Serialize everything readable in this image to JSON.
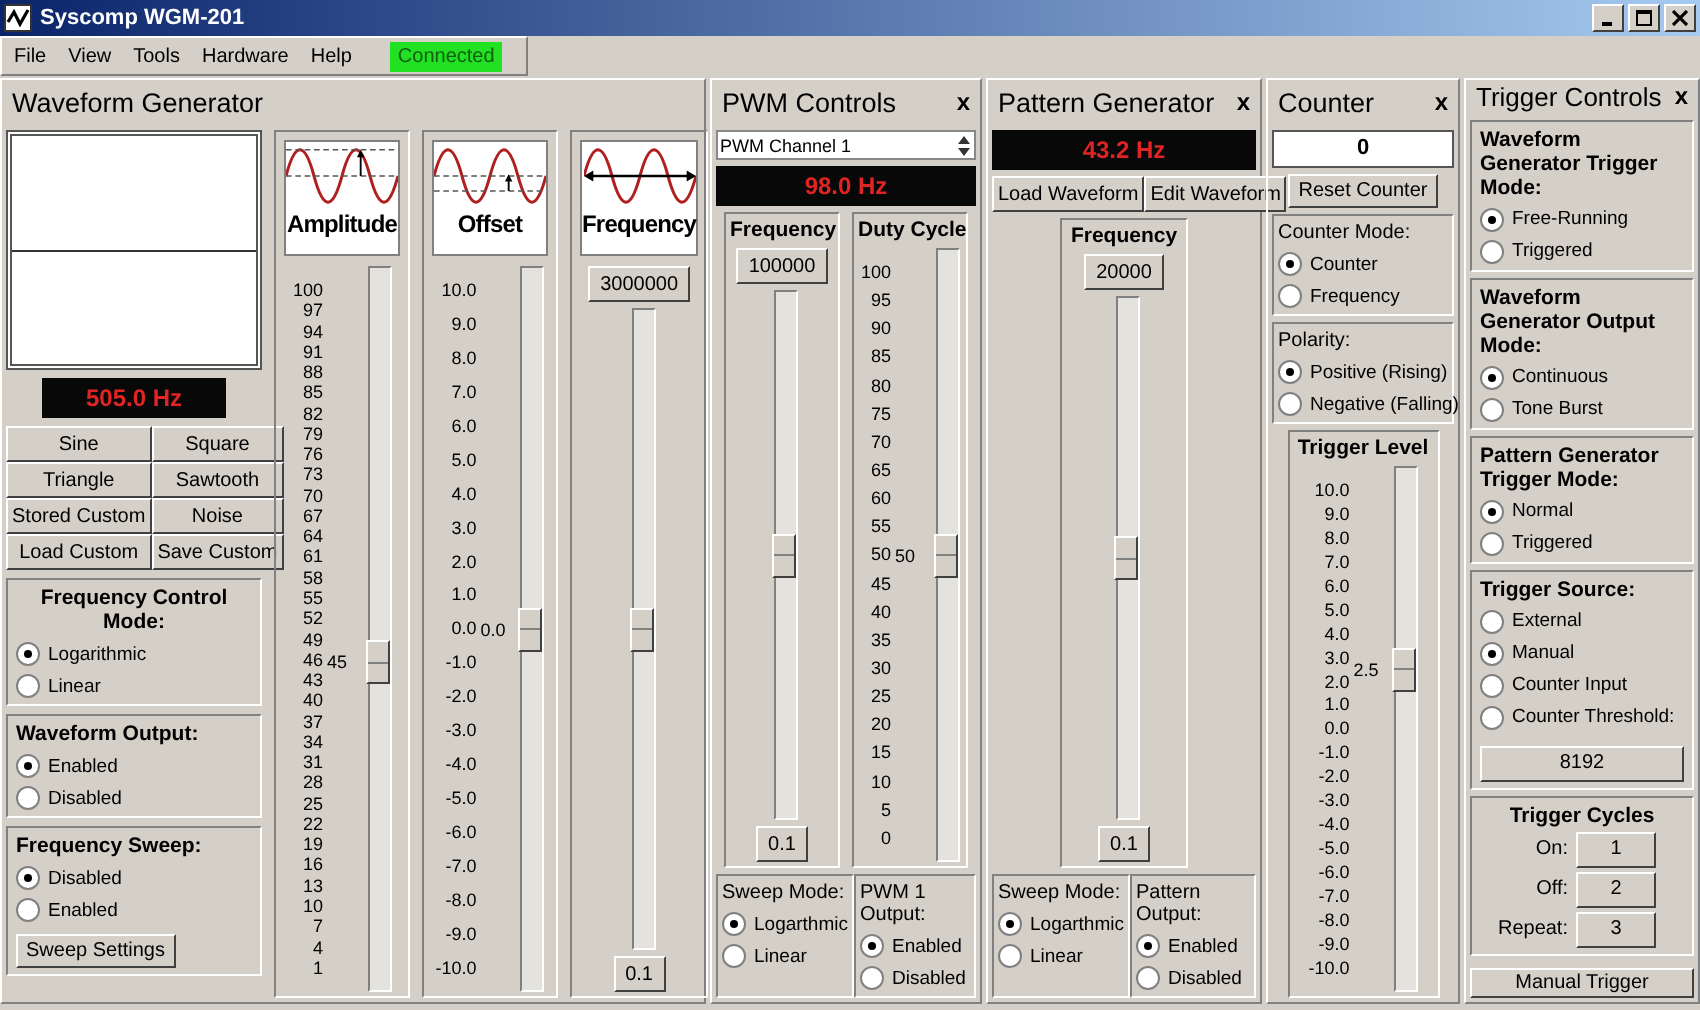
{
  "window": {
    "title": "Syscomp WGM-201"
  },
  "menu": [
    "File",
    "View",
    "Tools",
    "Hardware",
    "Help"
  ],
  "connection_status": "Connected",
  "waveform_generator": {
    "title": "Waveform Generator",
    "frequency_readout": "505.0 Hz",
    "wave_buttons": [
      "Sine",
      "Square",
      "Triangle",
      "Sawtooth",
      "Stored Custom",
      "Noise",
      "Load Custom",
      "Save Custom"
    ],
    "radio_groups": [
      {
        "title": "Frequency Control Mode:",
        "options": [
          {
            "label": "Logarithmic",
            "selected": true
          },
          {
            "label": "Linear",
            "selected": false
          }
        ]
      },
      {
        "title": "Waveform Output:",
        "options": [
          {
            "label": "Enabled",
            "selected": true
          },
          {
            "label": "Disabled",
            "selected": false
          }
        ]
      },
      {
        "title": "Frequency Sweep:",
        "options": [
          {
            "label": "Disabled",
            "selected": true
          },
          {
            "label": "Enabled",
            "selected": false
          }
        ]
      }
    ],
    "sweep_button": "Sweep Settings",
    "sliders": [
      {
        "kind": "amplitude",
        "caption": "Amplitude",
        "ticks": [
          "100",
          "97",
          "94",
          "91",
          "88",
          "85",
          "82",
          "79",
          "76",
          "73",
          "70",
          "67",
          "64",
          "61",
          "58",
          "55",
          "52",
          "49",
          "46",
          "43",
          "40",
          "37",
          "34",
          "31",
          "28",
          "25",
          "22",
          "19",
          "16",
          "13",
          "10",
          "7",
          "4",
          "1"
        ],
        "value_label": "45",
        "level": 0.45
      },
      {
        "kind": "offset",
        "caption": "Offset",
        "ticks": [
          "10.0",
          "9.0",
          "8.0",
          "7.0",
          "6.0",
          "5.0",
          "4.0",
          "3.0",
          "2.0",
          "1.0",
          "0.0",
          "-1.0",
          "-2.0",
          "-3.0",
          "-4.0",
          "-5.0",
          "-6.0",
          "-7.0",
          "-8.0",
          "-9.0",
          "-10.0"
        ],
        "value_label": "0.0",
        "level": 0.5
      },
      {
        "kind": "frequency",
        "caption": "Frequency",
        "top_button": "3000000",
        "bottom_button": "0.1",
        "level": 0.5
      }
    ]
  },
  "pwm_controls": {
    "title": "PWM Controls",
    "close": "x",
    "channel": "PWM Channel 1",
    "frequency_readout": "98.0 Hz",
    "sliders": [
      {
        "heading": "Frequency",
        "top_button": "100000",
        "bottom_button": "0.1",
        "level": 0.5
      },
      {
        "heading": "Duty Cycle",
        "ticks": [
          "100",
          "95",
          "90",
          "85",
          "80",
          "75",
          "70",
          "65",
          "60",
          "55",
          "50",
          "45",
          "40",
          "35",
          "30",
          "25",
          "20",
          "15",
          "10",
          "5",
          "0"
        ],
        "value_label": "50",
        "level": 0.5
      }
    ],
    "radio_groups": [
      {
        "title": "Sweep Mode:",
        "options": [
          {
            "label": "Logarthmic",
            "selected": true
          },
          {
            "label": "Linear",
            "selected": false
          }
        ]
      },
      {
        "title": "PWM 1 Output:",
        "options": [
          {
            "label": "Enabled",
            "selected": true
          },
          {
            "label": "Disabled",
            "selected": false
          }
        ]
      }
    ]
  },
  "pattern_generator": {
    "title": "Pattern Generator",
    "close": "x",
    "frequency_readout": "43.2 Hz",
    "buttons": [
      "Load Waveform",
      "Edit Waveform"
    ],
    "slider": {
      "heading": "Frequency",
      "top_button": "20000",
      "bottom_button": "0.1",
      "level": 0.5
    },
    "radio_groups": [
      {
        "title": "Sweep Mode:",
        "options": [
          {
            "label": "Logarthmic",
            "selected": true
          },
          {
            "label": "Linear",
            "selected": false
          }
        ]
      },
      {
        "title": "Pattern Output:",
        "options": [
          {
            "label": "Enabled",
            "selected": true
          },
          {
            "label": "Disabled",
            "selected": false
          }
        ]
      }
    ]
  },
  "counter": {
    "title": "Counter",
    "close": "x",
    "count": "0",
    "reset_button": "Reset Counter",
    "radio_groups": [
      {
        "title": "Counter Mode:",
        "options": [
          {
            "label": "Counter",
            "selected": true
          },
          {
            "label": "Frequency",
            "selected": false
          }
        ]
      },
      {
        "title": "Polarity:",
        "options": [
          {
            "label": "Positive (Rising)",
            "selected": true
          },
          {
            "label": "Negative (Falling)",
            "selected": false
          }
        ]
      }
    ],
    "slider": {
      "heading": "Trigger Level",
      "ticks": [
        "10.0",
        "9.0",
        "8.0",
        "7.0",
        "6.0",
        "5.0",
        "4.0",
        "3.0",
        "2.0",
        "1.0",
        "0.0",
        "-1.0",
        "-2.0",
        "-3.0",
        "-4.0",
        "-5.0",
        "-6.0",
        "-7.0",
        "-8.0",
        "-9.0",
        "-10.0"
      ],
      "value_label": "2.5",
      "level": 0.625
    }
  },
  "trigger_controls": {
    "title": "Trigger Controls",
    "close": "x",
    "radio_groups": [
      {
        "title": "Waveform Generator Trigger Mode:",
        "options": [
          {
            "label": "Free-Running",
            "selected": true
          },
          {
            "label": "Triggered",
            "selected": false
          }
        ]
      },
      {
        "title": "Waveform Generator Output Mode:",
        "options": [
          {
            "label": "Continuous",
            "selected": true
          },
          {
            "label": "Tone Burst",
            "selected": false
          }
        ]
      },
      {
        "title": "Pattern Generator Trigger Mode:",
        "options": [
          {
            "label": "Normal",
            "selected": true
          },
          {
            "label": "Triggered",
            "selected": false
          }
        ]
      },
      {
        "title": "Trigger Source:",
        "options": [
          {
            "label": "External",
            "selected": false
          },
          {
            "label": "Manual",
            "selected": true
          },
          {
            "label": "Counter Input",
            "selected": false
          },
          {
            "label": "Counter Threshold:",
            "selected": false
          }
        ]
      }
    ],
    "threshold_button": "8192",
    "cycles_title": "Trigger Cycles",
    "cycles": [
      {
        "label": "On:",
        "value": "1"
      },
      {
        "label": "Off:",
        "value": "2"
      },
      {
        "label": "Repeat:",
        "value": "3"
      }
    ],
    "manual_button": "Manual Trigger"
  }
}
